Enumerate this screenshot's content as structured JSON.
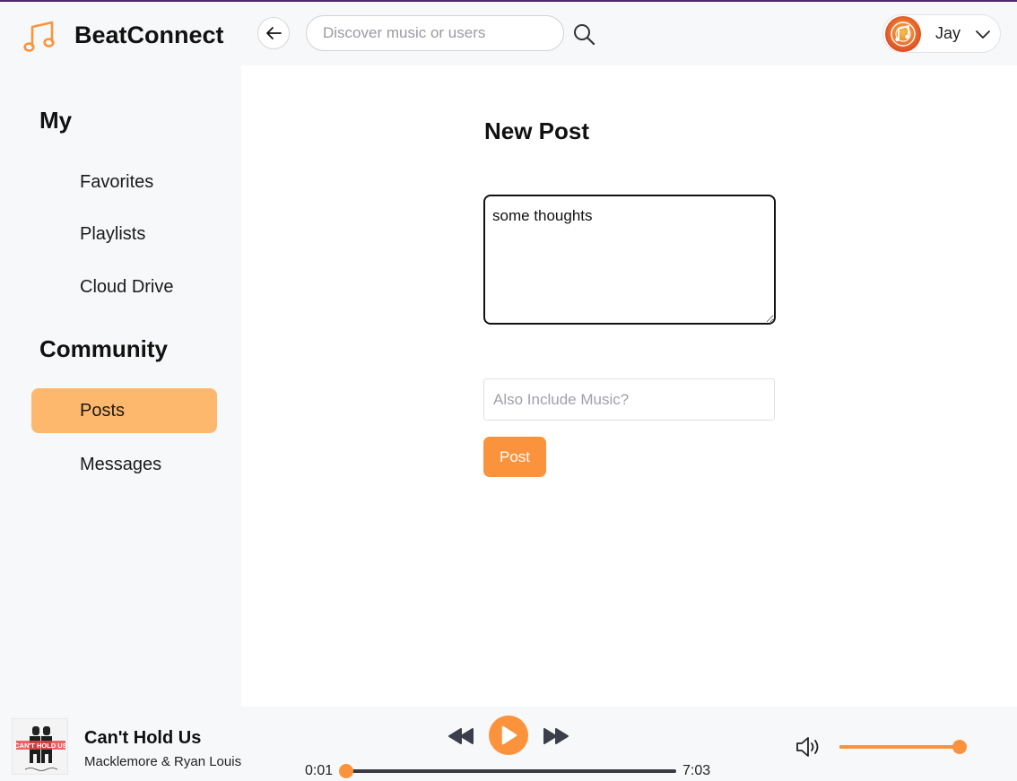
{
  "app": {
    "name": "BeatConnect",
    "accent_color": "#fb933d",
    "brand_icon": "music-notes-icon"
  },
  "header": {
    "search": {
      "placeholder": "Discover music or users",
      "value": ""
    },
    "user": {
      "name": "Jay",
      "avatar": "music-avatar"
    }
  },
  "sidebar": {
    "sections": [
      {
        "title": "My",
        "items": [
          {
            "label": "Favorites",
            "active": false
          },
          {
            "label": "Playlists",
            "active": false
          },
          {
            "label": "Cloud Drive",
            "active": false
          }
        ]
      },
      {
        "title": "Community",
        "items": [
          {
            "label": "Posts",
            "active": true
          },
          {
            "label": "Messages",
            "active": false
          }
        ]
      }
    ],
    "active_color": "#fdb86e"
  },
  "main": {
    "title": "New Post",
    "post_text": "some thoughts",
    "music_placeholder": "Also Include Music?",
    "post_button": "Post"
  },
  "player": {
    "track": {
      "title": "Can't Hold Us",
      "artist": "Macklemore & Ryan Louis"
    },
    "cover_text": "CAN'T HOLD US",
    "time_current": "0:01",
    "time_total": "7:03",
    "progress": 0.0,
    "volume": 1.0
  }
}
